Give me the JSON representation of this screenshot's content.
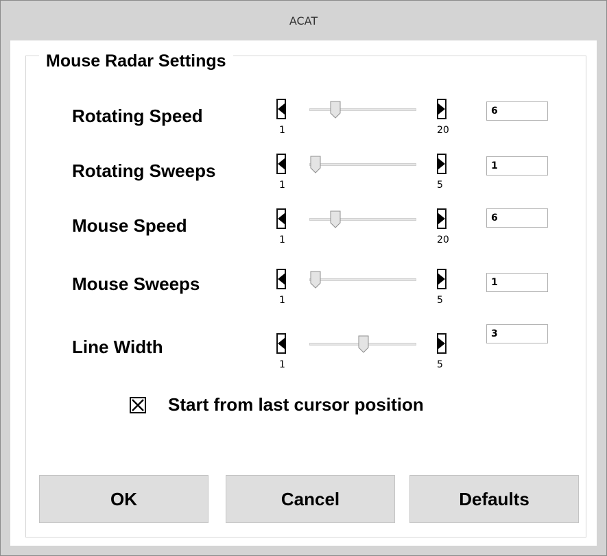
{
  "window": {
    "title": "ACAT"
  },
  "group": {
    "title": "Mouse Radar Settings"
  },
  "settings": [
    {
      "label": "Rotating Speed",
      "min": "1",
      "max": "20",
      "value": "6",
      "position": 5,
      "range": [
        1,
        20
      ]
    },
    {
      "label": "Rotating Sweeps",
      "min": "1",
      "max": "5",
      "value": "1",
      "position": 1,
      "range": [
        1,
        5
      ]
    },
    {
      "label": "Mouse Speed",
      "min": "1",
      "max": "20",
      "value": "6",
      "position": 5,
      "range": [
        1,
        20
      ]
    },
    {
      "label": "Mouse Sweeps",
      "min": "1",
      "max": "5",
      "value": "1",
      "position": 1,
      "range": [
        1,
        5
      ]
    },
    {
      "label": "Line Width",
      "min": "1",
      "max": "5",
      "value": "3",
      "position": 3,
      "range": [
        1,
        5
      ]
    }
  ],
  "checkbox": {
    "label": "Start from last cursor position",
    "checked": true
  },
  "buttons": {
    "ok": "OK",
    "cancel": "Cancel",
    "defaults": "Defaults"
  },
  "icons": {
    "decrease": "arrow-left-icon",
    "increase": "arrow-right-icon",
    "check": "x-check-icon"
  },
  "colors": {
    "frame": "#d4d4d4",
    "button": "#dedede",
    "track": "#e6e6e6"
  }
}
